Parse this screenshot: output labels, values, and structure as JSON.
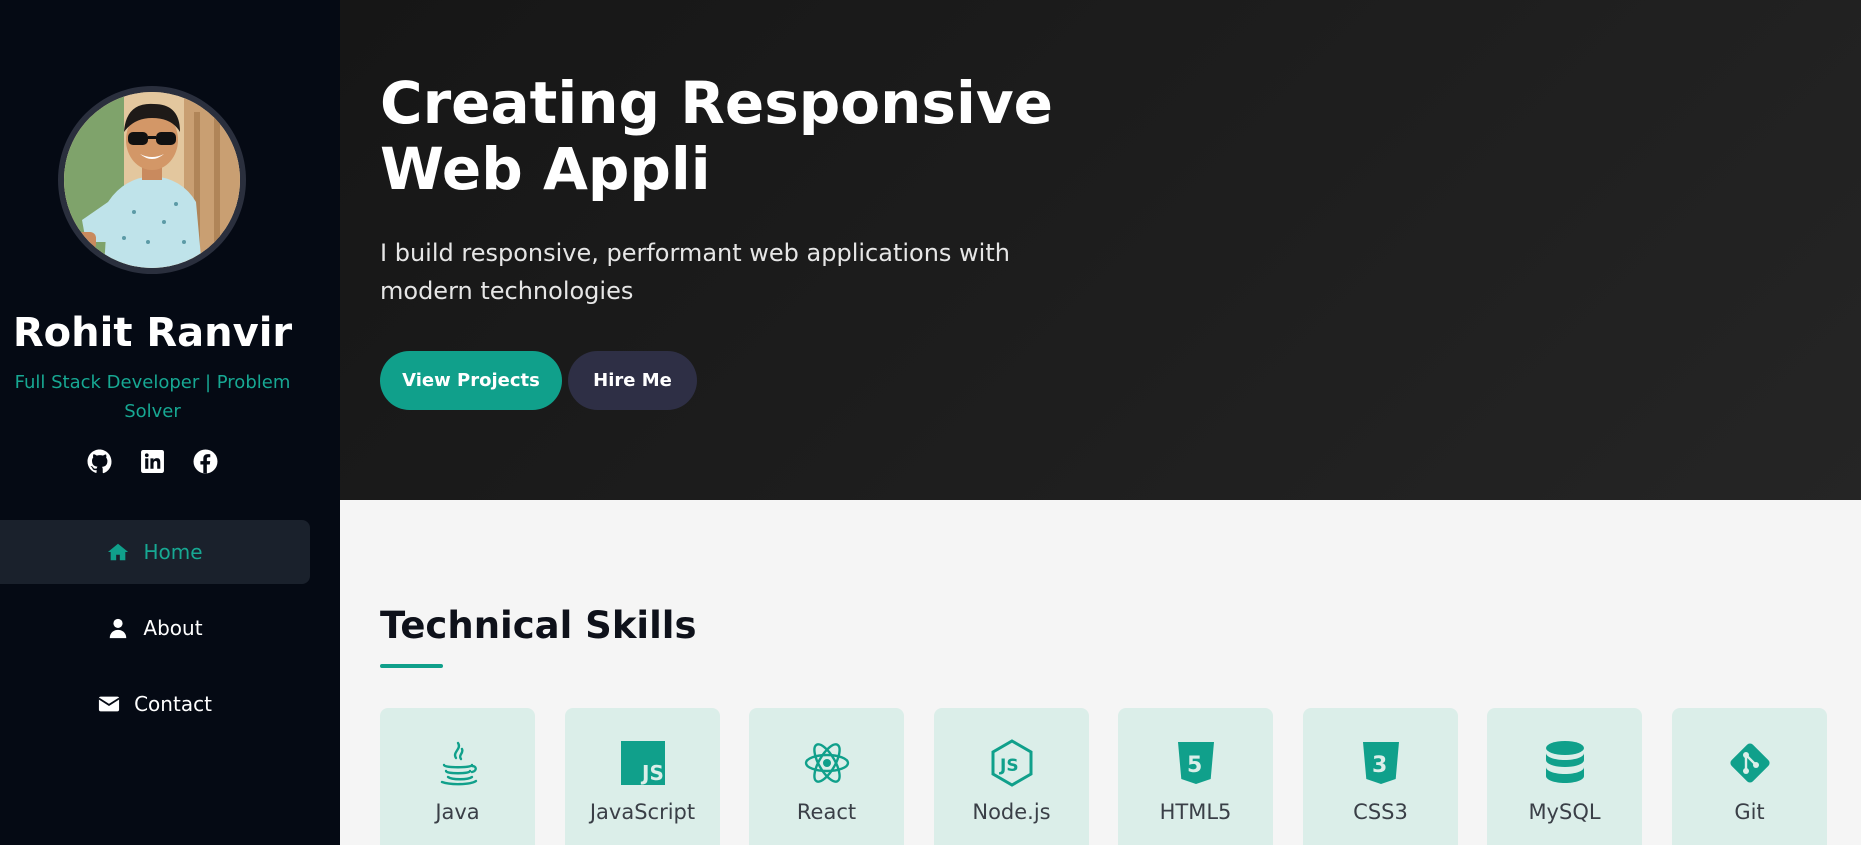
{
  "profile": {
    "name": "Rohit Ranvir",
    "role": "Full Stack Developer | Problem Solver"
  },
  "socials": [
    {
      "icon": "github-icon"
    },
    {
      "icon": "linkedin-icon"
    },
    {
      "icon": "facebook-icon"
    }
  ],
  "nav": {
    "items": [
      {
        "label": "Home",
        "icon": "home-icon",
        "active": true
      },
      {
        "label": "About",
        "icon": "user-icon",
        "active": false
      },
      {
        "label": "Contact",
        "icon": "envelope-icon",
        "active": false
      }
    ]
  },
  "hero": {
    "title": "Creating Responsive Web Appli",
    "subtitle": "I build responsive, performant web applications with modern technologies",
    "primary_button": "View Projects",
    "secondary_button": "Hire Me"
  },
  "skills": {
    "title": "Technical Skills",
    "items": [
      {
        "label": "Java",
        "icon": "java-icon"
      },
      {
        "label": "JavaScript",
        "icon": "javascript-icon"
      },
      {
        "label": "React",
        "icon": "react-icon"
      },
      {
        "label": "Node.js",
        "icon": "nodejs-icon"
      },
      {
        "label": "HTML5",
        "icon": "html5-icon"
      },
      {
        "label": "CSS3",
        "icon": "css3-icon"
      },
      {
        "label": "MySQL",
        "icon": "database-icon"
      },
      {
        "label": "Git",
        "icon": "git-icon"
      }
    ]
  },
  "colors": {
    "accent": "#10a08b",
    "sidebar_bg": "#050a14",
    "hero_bg": "#1e1e1e",
    "skill_card_bg": "#dbeee9"
  }
}
